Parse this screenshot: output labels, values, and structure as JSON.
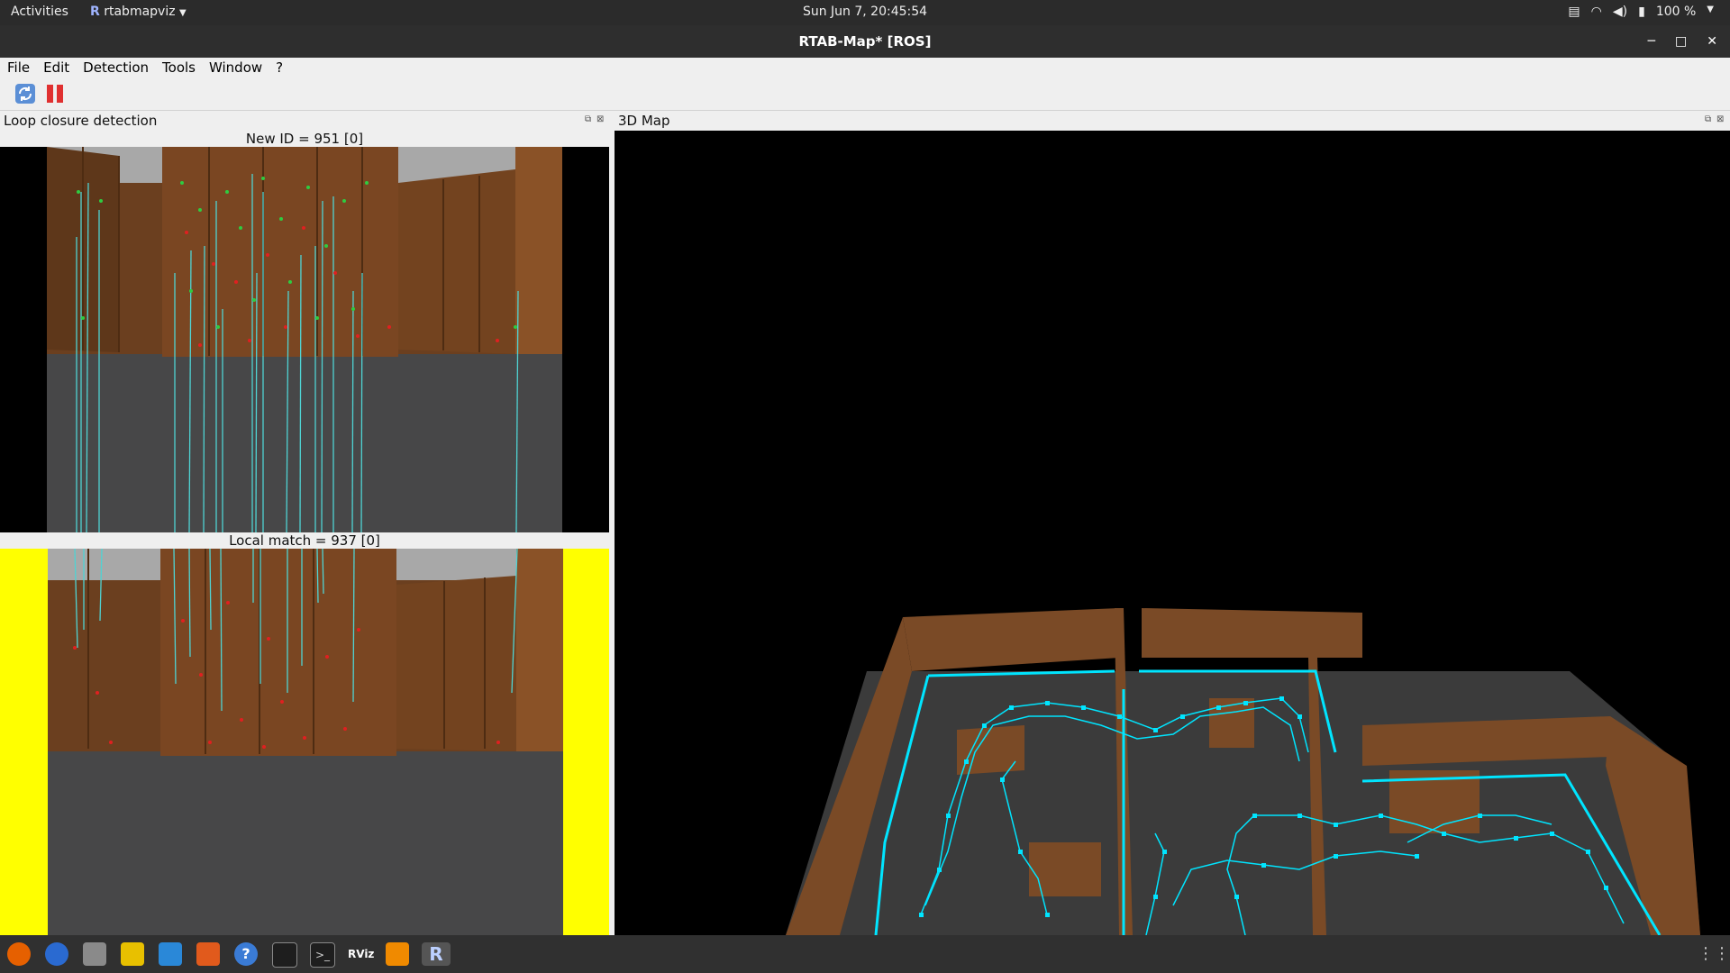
{
  "system_bar": {
    "activities": "Activities",
    "app_name": "rtabmapviz",
    "clock": "Sun Jun  7, 20:45:54",
    "battery": "100 %"
  },
  "window": {
    "title": "RTAB-Map* [ROS]"
  },
  "menubar": {
    "items": [
      "File",
      "Edit",
      "Detection",
      "Tools",
      "Window",
      "?"
    ]
  },
  "toolbar": {
    "buttons": [
      "refresh-icon",
      "pause-icon"
    ]
  },
  "loop_closure_panel": {
    "title": "Loop closure detection",
    "new_id_label": "New ID = 951 [0]",
    "local_match_label": "Local match = 937 [0]"
  },
  "map_panel": {
    "title": "3D Map"
  },
  "taskbar": {
    "rviz_label": "RViz",
    "rtab_label": "R"
  },
  "colors": {
    "feature_line": "#4fd3d3",
    "trajectory": "#00e5ff",
    "wall": "#7a4a26",
    "floor": "#4a4a4a",
    "highlight_bg": "#ffff00"
  }
}
